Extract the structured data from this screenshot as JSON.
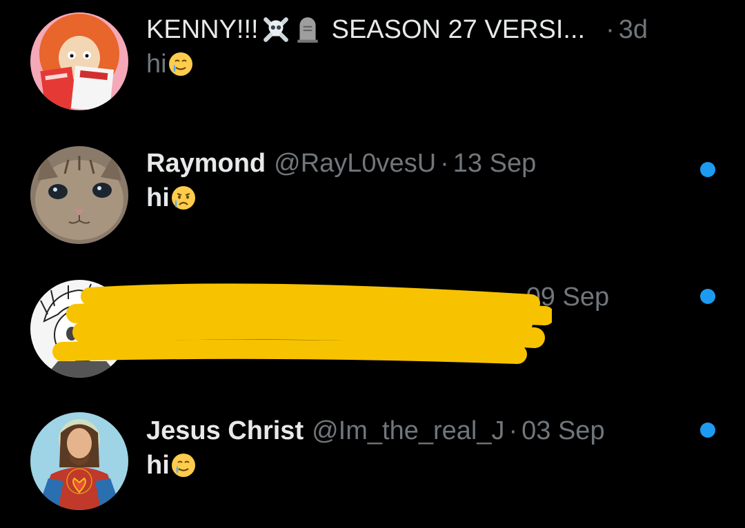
{
  "conversations": [
    {
      "name": "KENNY!!!",
      "name_suffix": "SEASON 27 VERSI...",
      "handle": "",
      "separator": "·",
      "time": "3d",
      "message": "hi",
      "unread": false,
      "avatar": "kenny-avatar",
      "emoji": "smiling-face-with-tear"
    },
    {
      "name": "Raymond",
      "name_suffix": "",
      "handle": "@RayL0vesU",
      "separator": "·",
      "time": "13 Sep",
      "message": "hi",
      "unread": true,
      "avatar": "kitten-avatar",
      "emoji": "crying-face"
    },
    {
      "name": "",
      "name_suffix": "",
      "handle": "",
      "separator": "·",
      "time": "09 Sep",
      "message": "",
      "unread": true,
      "avatar": "anime-sketch-avatar",
      "redacted": true
    },
    {
      "name": "Jesus Christ",
      "name_suffix": "",
      "handle": "@Im_the_real_J",
      "separator": "·",
      "time": "03 Sep",
      "message": "hi",
      "unread": true,
      "avatar": "jesus-avatar",
      "emoji": "smiling-face-with-tear"
    }
  ],
  "colors": {
    "background": "#000000",
    "primary_text": "#e7e9ea",
    "secondary_text": "#71767b",
    "unread_dot": "#1d9bf0",
    "scribble": "#f7c300"
  }
}
